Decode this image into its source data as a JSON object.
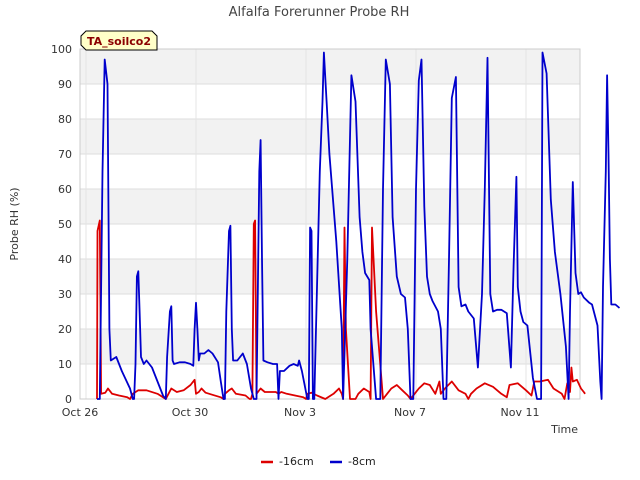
{
  "chart_data": {
    "type": "line",
    "title": "Alfalfa Forerunner Probe RH",
    "xlabel": "Time",
    "ylabel": "Probe RH (%)",
    "site_label": "TA_soilco2",
    "ylim": [
      0,
      100
    ],
    "yticks": [
      0,
      10,
      20,
      30,
      40,
      50,
      60,
      70,
      80,
      90,
      100
    ],
    "xlim": [
      0,
      18
    ],
    "xticks": [
      {
        "value": 0,
        "label": "Oct 26"
      },
      {
        "value": 4,
        "label": "Oct 30"
      },
      {
        "value": 8,
        "label": "Nov 3"
      },
      {
        "value": 12,
        "label": "Nov 7"
      },
      {
        "value": 16,
        "label": "Nov 11"
      }
    ],
    "x_unit": "days since Oct 26",
    "grid": true,
    "legend_position": "bottom-center",
    "series": [
      {
        "name": "-16cm",
        "color": "#dd0000",
        "points": [
          [
            0.4,
            0
          ],
          [
            0.42,
            48
          ],
          [
            0.5,
            51
          ],
          [
            0.55,
            1.5
          ],
          [
            0.7,
            1.8
          ],
          [
            0.8,
            3
          ],
          [
            0.95,
            1.5
          ],
          [
            1.2,
            1
          ],
          [
            1.5,
            0.5
          ],
          [
            1.6,
            0
          ],
          [
            1.7,
            1.5
          ],
          [
            1.9,
            2.5
          ],
          [
            2.2,
            2.5
          ],
          [
            2.6,
            1.5
          ],
          [
            2.8,
            0.5
          ],
          [
            2.9,
            0
          ],
          [
            3.0,
            1.5
          ],
          [
            3.1,
            3
          ],
          [
            3.3,
            2
          ],
          [
            3.55,
            2.5
          ],
          [
            3.8,
            4
          ],
          [
            3.95,
            5.5
          ],
          [
            4.0,
            1.5
          ],
          [
            4.1,
            2
          ],
          [
            4.2,
            3
          ],
          [
            4.35,
            1.8
          ],
          [
            4.6,
            1.2
          ],
          [
            4.9,
            0.5
          ],
          [
            5.0,
            0
          ],
          [
            5.05,
            1.5
          ],
          [
            5.2,
            2.5
          ],
          [
            5.3,
            3
          ],
          [
            5.45,
            1.5
          ],
          [
            5.8,
            1
          ],
          [
            5.95,
            0
          ],
          [
            6.0,
            0
          ],
          [
            6.05,
            1.5
          ],
          [
            6.1,
            50
          ],
          [
            6.15,
            51
          ],
          [
            6.2,
            1.5
          ],
          [
            6.35,
            3
          ],
          [
            6.5,
            2
          ],
          [
            6.7,
            2
          ],
          [
            6.9,
            2
          ],
          [
            7.0,
            1.5
          ],
          [
            7.1,
            2
          ],
          [
            7.3,
            1.5
          ],
          [
            7.6,
            1
          ],
          [
            7.9,
            0.5
          ],
          [
            8.0,
            0
          ],
          [
            8.05,
            1.5
          ],
          [
            8.2,
            1.8
          ],
          [
            8.4,
            1
          ],
          [
            8.7,
            0
          ],
          [
            8.8,
            0.5
          ],
          [
            9.0,
            1.5
          ],
          [
            9.2,
            3
          ],
          [
            9.3,
            1.5
          ],
          [
            9.35,
            0
          ],
          [
            9.4,
            49
          ],
          [
            9.45,
            20
          ],
          [
            9.6,
            0
          ],
          [
            9.8,
            0
          ],
          [
            9.9,
            1.5
          ],
          [
            10.1,
            3
          ],
          [
            10.3,
            2
          ],
          [
            10.35,
            0
          ],
          [
            10.4,
            49
          ],
          [
            10.55,
            25
          ],
          [
            10.8,
            0
          ],
          [
            10.95,
            1.5
          ],
          [
            11.1,
            3
          ],
          [
            11.3,
            4
          ],
          [
            11.5,
            2.5
          ],
          [
            11.7,
            1
          ],
          [
            11.8,
            0
          ],
          [
            11.95,
            1.5
          ],
          [
            12.1,
            3
          ],
          [
            12.3,
            4.5
          ],
          [
            12.5,
            4
          ],
          [
            12.7,
            1.5
          ],
          [
            12.85,
            5
          ],
          [
            12.9,
            1.5
          ],
          [
            13.05,
            3
          ],
          [
            13.3,
            5
          ],
          [
            13.55,
            2.5
          ],
          [
            13.8,
            1.5
          ],
          [
            13.9,
            0
          ],
          [
            14.0,
            1.5
          ],
          [
            14.2,
            3
          ],
          [
            14.5,
            4.5
          ],
          [
            14.8,
            3.5
          ],
          [
            15.1,
            1.5
          ],
          [
            15.3,
            0.5
          ],
          [
            15.4,
            4
          ],
          [
            15.7,
            4.5
          ],
          [
            16.0,
            2.5
          ],
          [
            16.2,
            1
          ],
          [
            16.3,
            5
          ],
          [
            16.5,
            5
          ],
          [
            16.8,
            5.5
          ],
          [
            17.0,
            3
          ],
          [
            17.3,
            1.5
          ],
          [
            17.4,
            0
          ],
          [
            17.5,
            4.5
          ],
          [
            17.6,
            2
          ],
          [
            17.65,
            9
          ],
          [
            17.7,
            5
          ],
          [
            17.85,
            5.5
          ],
          [
            18.0,
            3
          ],
          [
            18.1,
            2
          ],
          [
            18.15,
            1.5
          ]
        ]
      },
      {
        "name": "-8cm",
        "color": "#0000cc",
        "points": [
          [
            0.4,
            0
          ],
          [
            0.5,
            0
          ],
          [
            0.6,
            65
          ],
          [
            0.68,
            97
          ],
          [
            0.78,
            90
          ],
          [
            0.85,
            20
          ],
          [
            0.9,
            11
          ],
          [
            1.0,
            11.5
          ],
          [
            1.1,
            12
          ],
          [
            1.3,
            8
          ],
          [
            1.6,
            3
          ],
          [
            1.7,
            0
          ],
          [
            1.75,
            0
          ],
          [
            1.8,
            10
          ],
          [
            1.85,
            35
          ],
          [
            1.9,
            36.5
          ],
          [
            1.95,
            25
          ],
          [
            2.0,
            12
          ],
          [
            2.05,
            11
          ],
          [
            2.1,
            10
          ],
          [
            2.2,
            11
          ],
          [
            2.4,
            9
          ],
          [
            2.6,
            5
          ],
          [
            2.8,
            1
          ],
          [
            2.9,
            0
          ],
          [
            2.95,
            12
          ],
          [
            3.05,
            25
          ],
          [
            3.1,
            26.5
          ],
          [
            3.15,
            11
          ],
          [
            3.2,
            10
          ],
          [
            3.4,
            10.5
          ],
          [
            3.6,
            10.5
          ],
          [
            3.8,
            10
          ],
          [
            3.9,
            9.5
          ],
          [
            3.95,
            20
          ],
          [
            4.0,
            27.5
          ],
          [
            4.05,
            20
          ],
          [
            4.1,
            11
          ],
          [
            4.15,
            13
          ],
          [
            4.3,
            13
          ],
          [
            4.45,
            14
          ],
          [
            4.6,
            13
          ],
          [
            4.8,
            10.5
          ],
          [
            4.9,
            5
          ],
          [
            5.0,
            0
          ],
          [
            5.05,
            0
          ],
          [
            5.1,
            25
          ],
          [
            5.2,
            48
          ],
          [
            5.25,
            49.5
          ],
          [
            5.3,
            20
          ],
          [
            5.35,
            11
          ],
          [
            5.5,
            11
          ],
          [
            5.7,
            13
          ],
          [
            5.85,
            10
          ],
          [
            6.0,
            3
          ],
          [
            6.1,
            0
          ],
          [
            6.2,
            0
          ],
          [
            6.3,
            65
          ],
          [
            6.35,
            74
          ],
          [
            6.4,
            40
          ],
          [
            6.45,
            11
          ],
          [
            6.6,
            10.5
          ],
          [
            6.8,
            10
          ],
          [
            6.95,
            10
          ],
          [
            7.0,
            0
          ],
          [
            7.05,
            8
          ],
          [
            7.2,
            8
          ],
          [
            7.4,
            9.5
          ],
          [
            7.55,
            10
          ],
          [
            7.7,
            9.5
          ],
          [
            7.75,
            11
          ],
          [
            7.85,
            8
          ],
          [
            8.0,
            2
          ],
          [
            8.05,
            0
          ],
          [
            8.1,
            0
          ],
          [
            8.15,
            49
          ],
          [
            8.2,
            48
          ],
          [
            8.25,
            0
          ],
          [
            8.3,
            0
          ],
          [
            8.5,
            65
          ],
          [
            8.6,
            85
          ],
          [
            8.65,
            99
          ],
          [
            8.75,
            85
          ],
          [
            8.85,
            70
          ],
          [
            9.1,
            45
          ],
          [
            9.3,
            20
          ],
          [
            9.35,
            0
          ],
          [
            9.5,
            40
          ],
          [
            9.65,
            92.5
          ],
          [
            9.8,
            85
          ],
          [
            9.95,
            52
          ],
          [
            10.05,
            42
          ],
          [
            10.15,
            36
          ],
          [
            10.3,
            34
          ],
          [
            10.35,
            20
          ],
          [
            10.55,
            0
          ],
          [
            10.7,
            0
          ],
          [
            10.8,
            60
          ],
          [
            10.9,
            97
          ],
          [
            11.05,
            90
          ],
          [
            11.15,
            52
          ],
          [
            11.3,
            35
          ],
          [
            11.45,
            30
          ],
          [
            11.6,
            29
          ],
          [
            11.7,
            20
          ],
          [
            11.8,
            0
          ],
          [
            11.9,
            0
          ],
          [
            12.0,
            60
          ],
          [
            12.1,
            91
          ],
          [
            12.2,
            97
          ],
          [
            12.3,
            55
          ],
          [
            12.4,
            35
          ],
          [
            12.5,
            30
          ],
          [
            12.6,
            28
          ],
          [
            12.8,
            25
          ],
          [
            12.9,
            20
          ],
          [
            13.0,
            0
          ],
          [
            13.1,
            0
          ],
          [
            13.2,
            40
          ],
          [
            13.3,
            86
          ],
          [
            13.45,
            92
          ],
          [
            13.55,
            32
          ],
          [
            13.65,
            26.5
          ],
          [
            13.8,
            27
          ],
          [
            13.9,
            25
          ],
          [
            14.1,
            23
          ],
          [
            14.25,
            9
          ],
          [
            14.4,
            30
          ],
          [
            14.5,
            60
          ],
          [
            14.6,
            97.5
          ],
          [
            14.7,
            30
          ],
          [
            14.8,
            25
          ],
          [
            14.95,
            25.5
          ],
          [
            15.1,
            25.5
          ],
          [
            15.3,
            24.5
          ],
          [
            15.45,
            9
          ],
          [
            15.55,
            38
          ],
          [
            15.65,
            63.5
          ],
          [
            15.7,
            32
          ],
          [
            15.8,
            25
          ],
          [
            15.9,
            22
          ],
          [
            16.05,
            21
          ],
          [
            16.25,
            6
          ],
          [
            16.4,
            0
          ],
          [
            16.55,
            0
          ],
          [
            16.6,
            99
          ],
          [
            16.75,
            93
          ],
          [
            16.9,
            57
          ],
          [
            17.05,
            42
          ],
          [
            17.25,
            30
          ],
          [
            17.45,
            15
          ],
          [
            17.55,
            0
          ],
          [
            17.6,
            25
          ],
          [
            17.7,
            62
          ],
          [
            17.8,
            36
          ],
          [
            17.9,
            30
          ],
          [
            18.0,
            30.5
          ],
          [
            18.1,
            29
          ],
          [
            18.3,
            27.5
          ],
          [
            18.4,
            27
          ],
          [
            18.6,
            21
          ],
          [
            18.7,
            5
          ],
          [
            18.75,
            0
          ],
          [
            18.8,
            32
          ],
          [
            18.9,
            65
          ],
          [
            18.95,
            92.5
          ],
          [
            19.0,
            70
          ],
          [
            19.05,
            40
          ],
          [
            19.1,
            27
          ],
          [
            19.25,
            27
          ],
          [
            19.4,
            26
          ]
        ]
      }
    ]
  }
}
